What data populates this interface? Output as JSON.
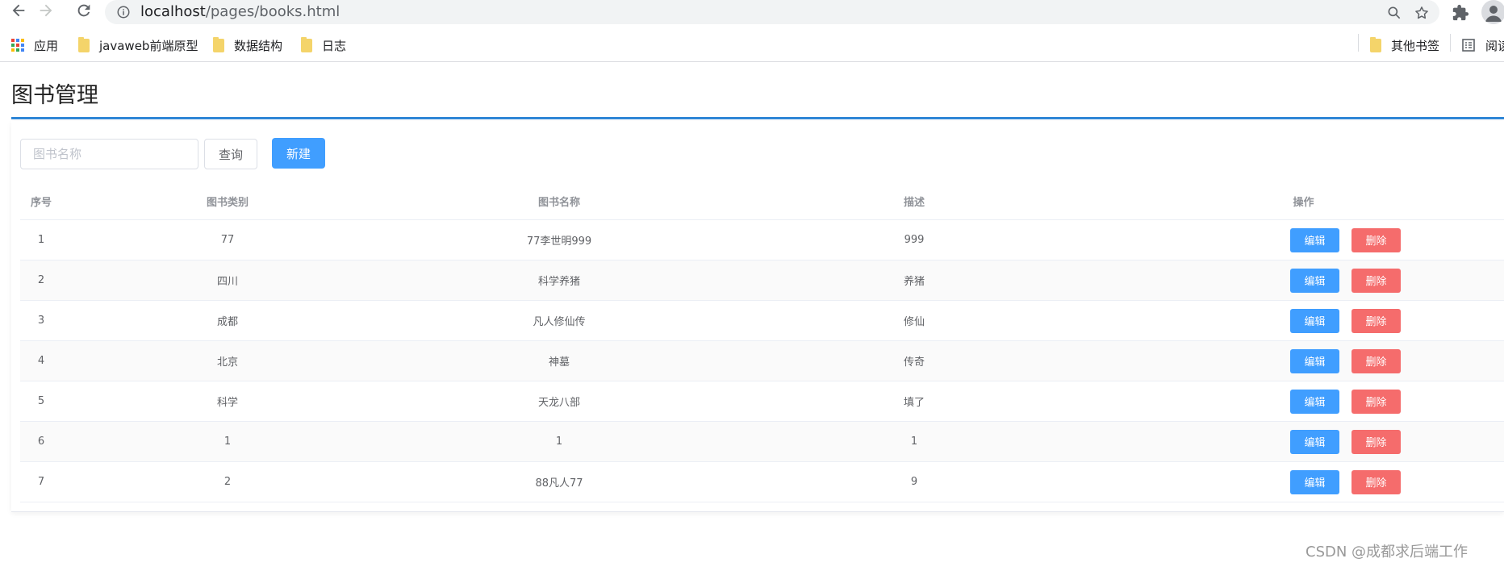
{
  "browser": {
    "url_host": "localhost",
    "url_path": "/pages/books.html",
    "bookmarks": [
      {
        "label": "应用",
        "kind": "apps"
      },
      {
        "label": "javaweb前端原型",
        "kind": "folder"
      },
      {
        "label": "数据结构",
        "kind": "folder"
      },
      {
        "label": "日志",
        "kind": "folder"
      }
    ],
    "bookmarks_right": [
      {
        "label": "其他书签",
        "kind": "folder"
      },
      {
        "label": "阅读",
        "kind": "reading-list"
      }
    ]
  },
  "page": {
    "title": "图书管理",
    "search": {
      "placeholder": "图书名称",
      "value": ""
    },
    "query_button": "查询",
    "new_button": "新建"
  },
  "table": {
    "headers": {
      "id": "序号",
      "category": "图书类别",
      "name": "图书名称",
      "desc": "描述",
      "ops": "操作"
    },
    "edit_label": "编辑",
    "delete_label": "删除",
    "rows": [
      {
        "id": "1",
        "category": "77",
        "name": "77李世明999",
        "desc": "999"
      },
      {
        "id": "2",
        "category": "四川",
        "name": "科学养猪",
        "desc": "养猪"
      },
      {
        "id": "3",
        "category": "成都",
        "name": "凡人修仙传",
        "desc": "修仙"
      },
      {
        "id": "4",
        "category": "北京",
        "name": "神墓",
        "desc": "传奇"
      },
      {
        "id": "5",
        "category": "科学",
        "name": "天龙八部",
        "desc": "填了"
      },
      {
        "id": "6",
        "category": "1",
        "name": "1",
        "desc": "1"
      },
      {
        "id": "7",
        "category": "2",
        "name": "88凡人77",
        "desc": "9"
      }
    ]
  },
  "watermark": "CSDN @成都求后端工作",
  "colors": {
    "primary": "#409eff",
    "danger": "#f56c6c",
    "title_rule": "#2f86d6"
  }
}
